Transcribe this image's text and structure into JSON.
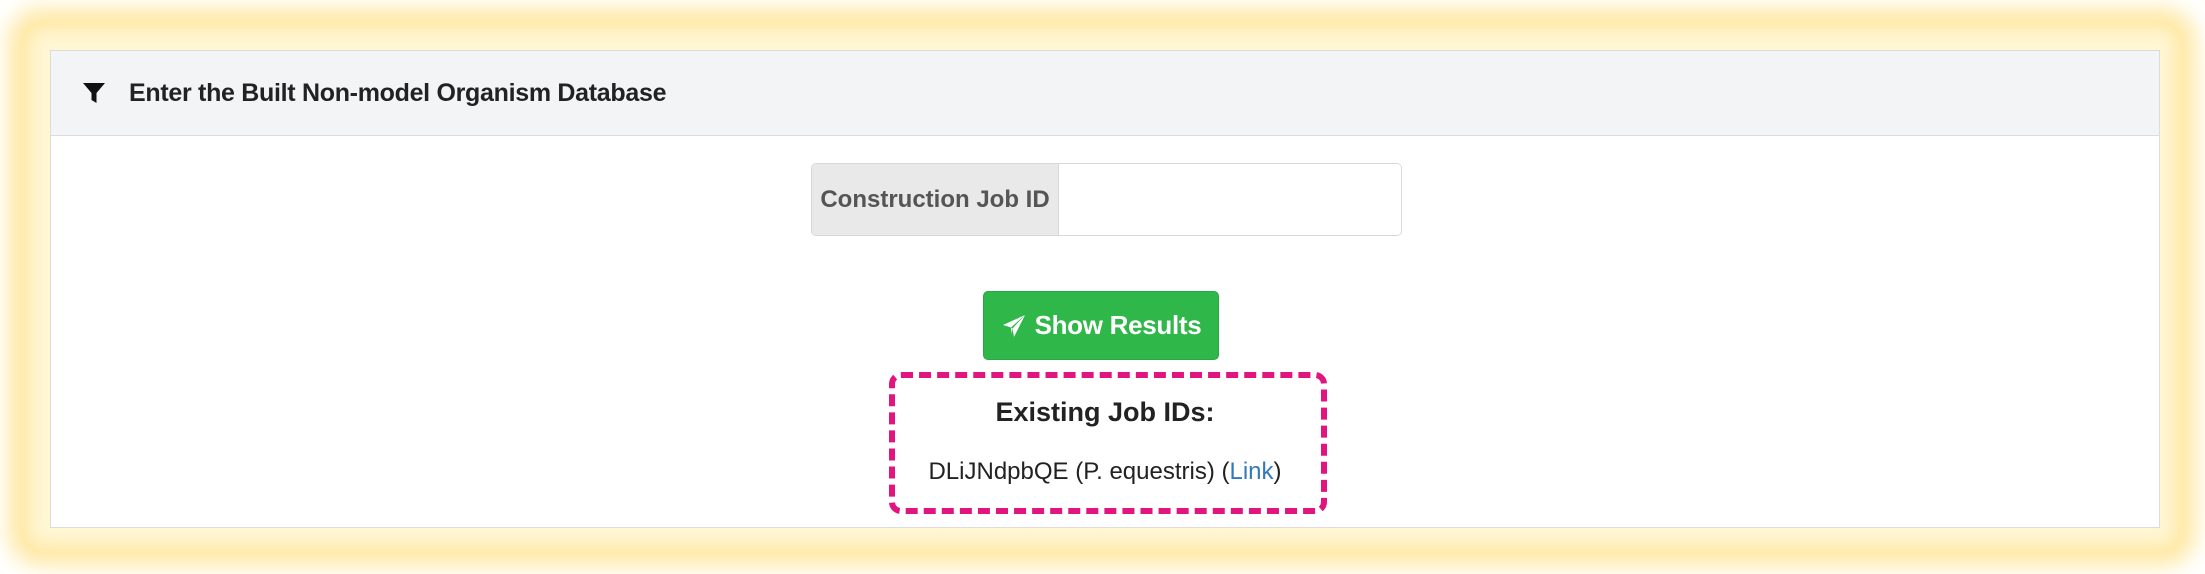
{
  "panel": {
    "heading": "Enter the Built Non-model Organism Database",
    "heading_icon": "filter-icon"
  },
  "form": {
    "job_id_label": "Construction Job ID",
    "job_id_value": "",
    "job_id_placeholder": "",
    "submit_label": "Show Results",
    "submit_icon": "paper-plane-icon"
  },
  "existing": {
    "title": "Existing Job IDs:",
    "jobs": [
      {
        "id": "DLiJNdpbQE",
        "organism": "(P. equestris)",
        "link_open": "(",
        "link_label": "Link",
        "link_close": ")"
      }
    ]
  },
  "colors": {
    "button_green": "#2fb74a",
    "highlight_magenta": "#e0157f",
    "link_blue": "#337ab7",
    "glow_yellow": "#ffe9a6"
  }
}
